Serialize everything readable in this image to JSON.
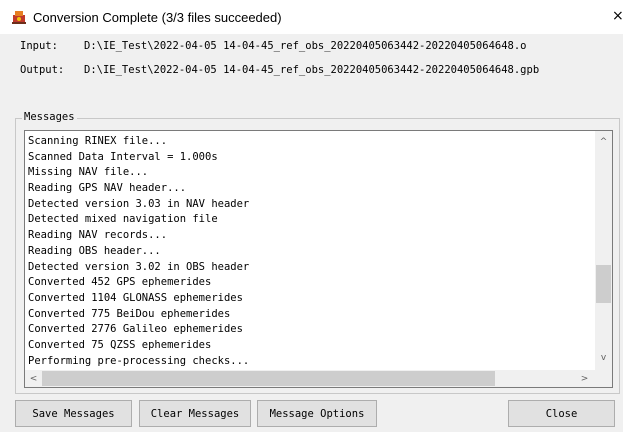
{
  "window": {
    "title": "Conversion Complete (3/3 files succeeded)",
    "close_glyph": "×",
    "icon": "app-icon"
  },
  "files": {
    "input_label": "Input:",
    "input_value": "D:\\IE_Test\\2022-04-05 14-04-45_ref_obs_20220405063442-20220405064648.o",
    "output_label": "Output:",
    "output_value": "D:\\IE_Test\\2022-04-05 14-04-45_ref_obs_20220405063442-20220405064648.gpb"
  },
  "messages": {
    "group_label": "Messages",
    "lines": [
      "Scanning RINEX file...",
      "Scanned Data Interval = 1.000s",
      "Missing NAV file...",
      "Reading GPS NAV header...",
      "Detected version 3.03 in NAV header",
      "Detected mixed navigation file",
      "Reading NAV records...",
      "Reading OBS header...",
      "Detected version 3.02 in OBS header",
      "Converted 452 GPS ephemerides",
      "Converted 1104 GLONASS ephemerides",
      "Converted 775 BeiDou ephemerides",
      "Converted 2776 Galileo ephemerides",
      "Converted 75 QZSS ephemerides",
      "Performing pre-processing checks..."
    ],
    "scroll_up": "^",
    "scroll_down": "v",
    "scroll_left": "<",
    "scroll_right": ">"
  },
  "buttons": {
    "save": "Save Messages",
    "clear": "Clear Messages",
    "options": "Message Options",
    "close": "Close"
  }
}
